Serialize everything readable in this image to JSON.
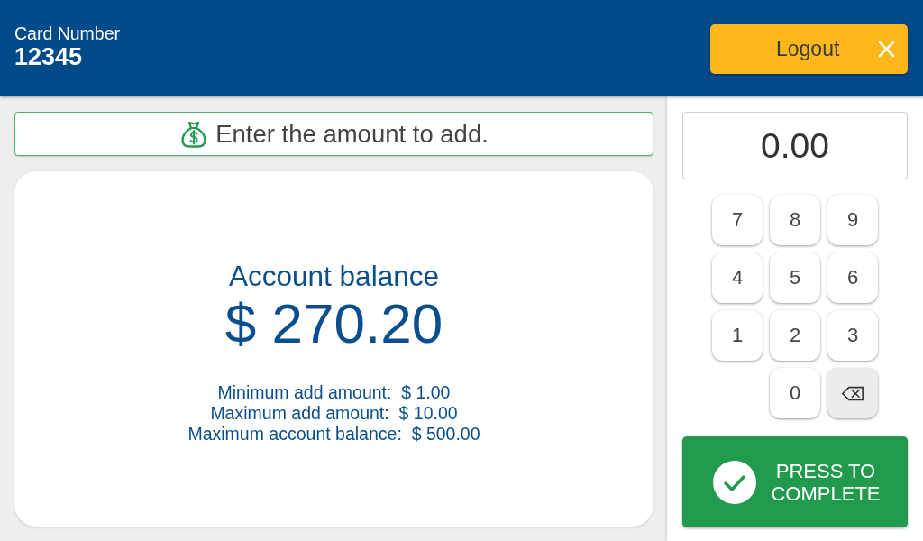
{
  "header": {
    "card_label": "Card Number",
    "card_number": "12345",
    "logout_button": "Logout"
  },
  "prompt": {
    "text": "Enter the amount to add."
  },
  "balance": {
    "title": "Account balance",
    "amount": "$ 270.20",
    "limits": [
      "Minimum add amount:  $ 1.00",
      "Maximum add amount:  $ 10.00",
      "Maximum account balance:  $ 500.00"
    ]
  },
  "amount_field": {
    "value": "0.00"
  },
  "keypad": {
    "rows": [
      [
        {
          "kind": "digit",
          "label": "7"
        },
        {
          "kind": "digit",
          "label": "8"
        },
        {
          "kind": "digit",
          "label": "9"
        }
      ],
      [
        {
          "kind": "digit",
          "label": "4"
        },
        {
          "kind": "digit",
          "label": "5"
        },
        {
          "kind": "digit",
          "label": "6"
        }
      ],
      [
        {
          "kind": "digit",
          "label": "1"
        },
        {
          "kind": "digit",
          "label": "2"
        },
        {
          "kind": "digit",
          "label": "3"
        }
      ],
      [
        "",
        {
          "kind": "digit",
          "label": "0"
        },
        {
          "kind": "backspace"
        }
      ]
    ]
  },
  "complete_button": {
    "label": "PRESS TO COMPLETE"
  }
}
